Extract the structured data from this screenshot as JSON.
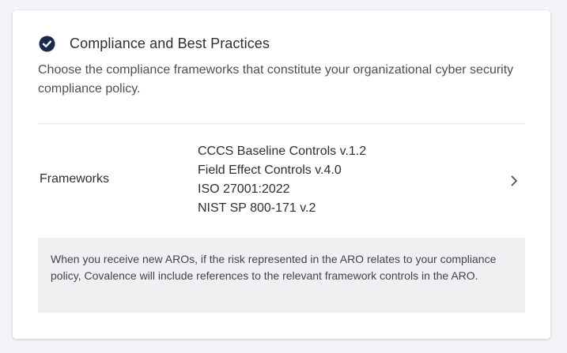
{
  "section": {
    "title": "Compliance and Best Practices",
    "description": "Choose the compliance frameworks that constitute your organizational cyber security compliance policy.",
    "status_icon": "check-circle-icon",
    "accent_color": "#1b2a4a"
  },
  "frameworks": {
    "label": "Frameworks",
    "items": [
      "CCCS Baseline Controls v.1.2",
      "Field Effect Controls v.4.0",
      "ISO 27001:2022",
      "NIST SP 800-171 v.2"
    ],
    "action_icon": "chevron-right-icon"
  },
  "info": {
    "text": "When you receive new AROs, if the risk represented in the ARO relates to your compliance policy, Covalence will include references to the relevant framework controls in the ARO."
  }
}
